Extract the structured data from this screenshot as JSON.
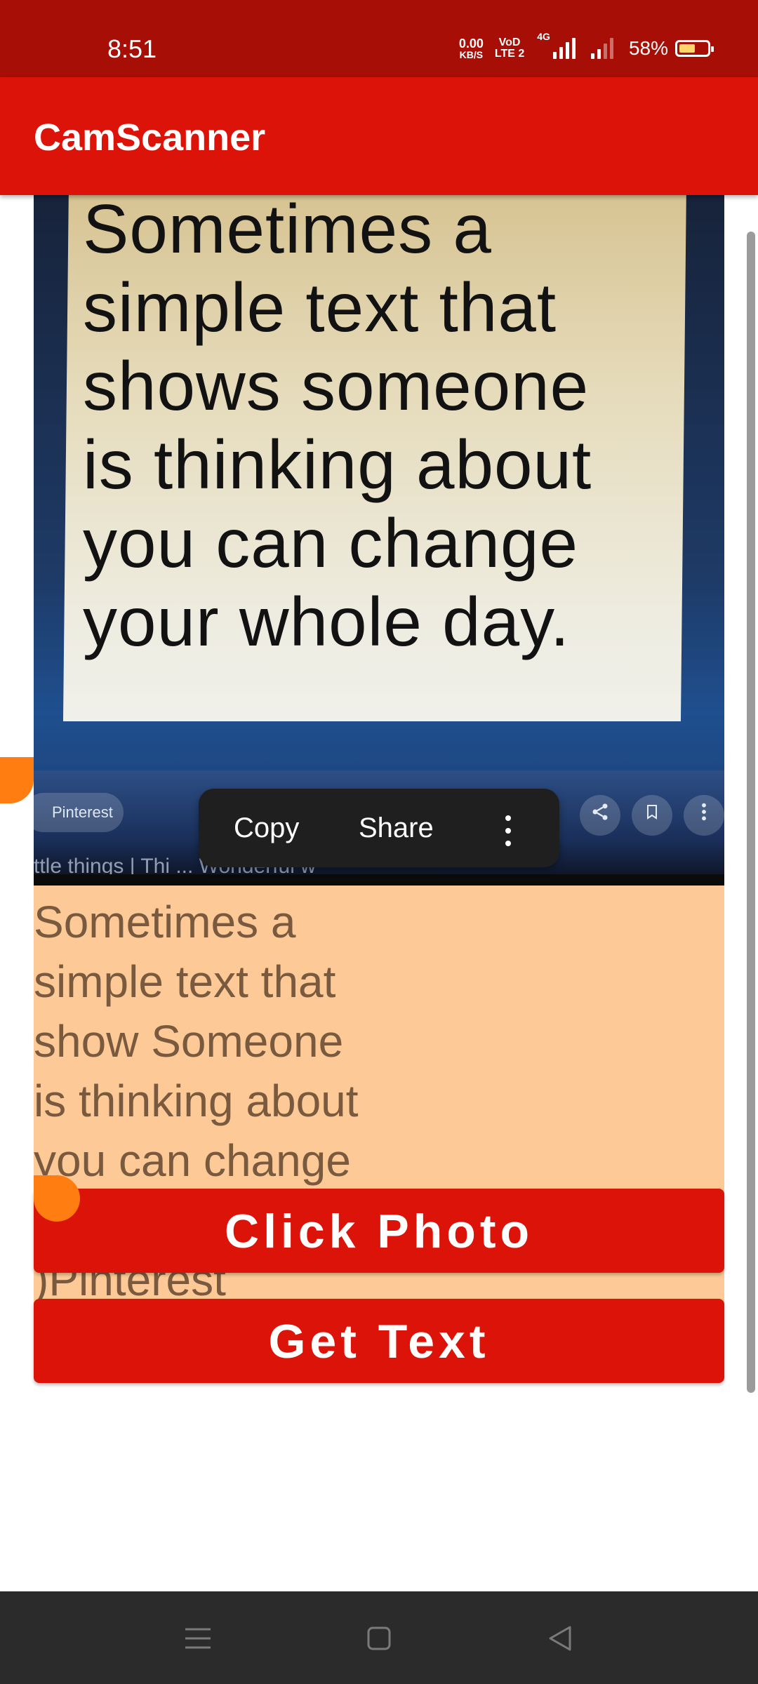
{
  "status_bar": {
    "time": "8:51",
    "net_speed_value": "0.00",
    "net_speed_unit": "KB/S",
    "volte_top": "VoD",
    "volte_bottom": "LTE 2",
    "network_type": "4G",
    "battery": "58%"
  },
  "app_bar": {
    "title": "CamScanner"
  },
  "photo": {
    "text": "Sometimes a\nsimple text that\nshows someone\nis thinking about\nyou can change\nyour whole day.",
    "chip_label": "Pinterest",
    "caption": "ttle things | Thi                                                        ... Wonderful w"
  },
  "context_menu": {
    "copy": "Copy",
    "share": "Share"
  },
  "result": {
    "text": "Sometimes a\nsimple text that\nshow Someone\nis thinking about\nyou can change\nyour whole day.\n)Pinterest"
  },
  "buttons": {
    "click_photo": "Click Photo",
    "get_text": "Get Text"
  },
  "colors": {
    "status_bar": "#a60e06",
    "app_bar": "#dc1308",
    "highlight": "#fdc996",
    "handle": "#ff7d11",
    "nav_bar": "#2b2b2b"
  },
  "icons": {
    "share": "share-icon",
    "bookmark": "bookmark-icon",
    "more": "more-vert-icon",
    "nav_menu": "menu-icon",
    "nav_home": "home-icon",
    "nav_back": "back-icon"
  }
}
